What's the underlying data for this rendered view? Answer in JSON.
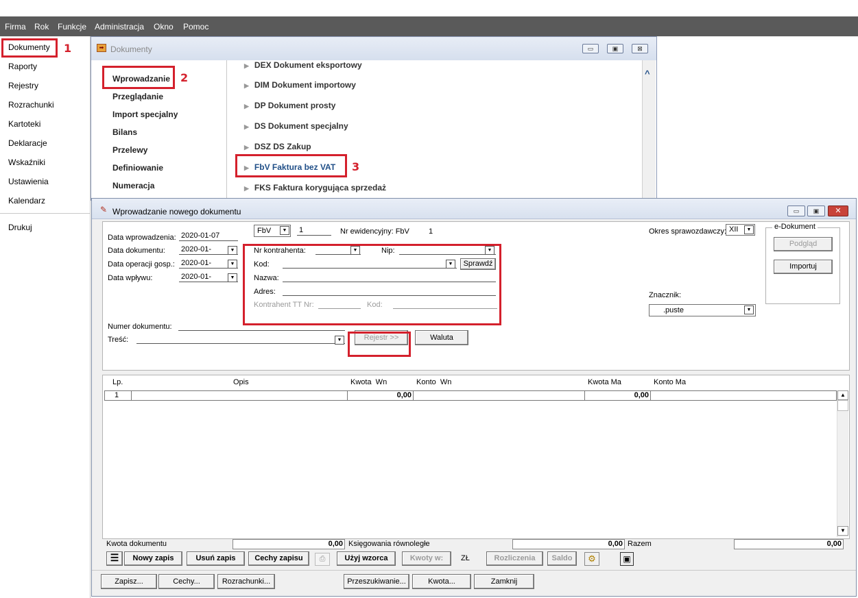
{
  "menubar": [
    "Firma",
    "Rok",
    "Funkcje",
    "Administracja",
    "Okno",
    "Pomoc"
  ],
  "sidebar": {
    "items": [
      "Dokumenty",
      "Raporty",
      "Rejestry",
      "Rozrachunki",
      "Kartoteki",
      "Deklaracje",
      "Wskaźniki",
      "Ustawienia",
      "Kalendarz",
      "Drukuj"
    ]
  },
  "callouts": [
    "1",
    "2",
    "3"
  ],
  "docwin": {
    "title": "Dokumenty",
    "nav": [
      "Wprowadzanie",
      "Przeglądanie",
      "Import specjalny",
      "Bilans",
      "Przelewy",
      "Definiowanie",
      "Numeracja"
    ],
    "documents": [
      "DEX Dokument eksportowy",
      "DIM Dokument importowy",
      "DP Dokument prosty",
      "DS Dokument specjalny",
      "DSZ DS Zakup",
      "FbV Faktura bez VAT",
      "FKS Faktura korygująca sprzedaż"
    ],
    "win_min": "▭",
    "win_max": "▣",
    "win_close": "⊠"
  },
  "dialog": {
    "title": "Wprowadzanie nowego dokumentu",
    "win_min": "▭",
    "win_max": "▣",
    "win_close": "✕",
    "doc_type": "FbV",
    "doc_no": "1",
    "nr_ewid_label": "Nr ewidencyjny: FbV",
    "nr_ewid_value": "1",
    "dates": {
      "wprow_label": "Data wprowadzenia:",
      "wprow_value": "2020-01-07",
      "dok_label": "Data dokumentu:",
      "dok_value": "2020-01-",
      "oper_label": "Data operacji gosp.:",
      "oper_value": "2020-01-",
      "wplyw_label": "Data wpływu:",
      "wplyw_value": "2020-01-"
    },
    "kontrahent": {
      "nr_label": "Nr kontrahenta:",
      "nip_label": "Nip:",
      "kod_label": "Kod:",
      "sprawdz_label": "Sprawdź",
      "nazwa_label": "Nazwa:",
      "adres_label": "Adres:",
      "tt_label": "Kontrahent TT Nr:",
      "tt_kod_label": "Kod:"
    },
    "okres_label": "Okres sprawozdawczy:",
    "okres_value": "XII",
    "edok": {
      "title": "e-Dokument",
      "podglad": "Podgląd",
      "importuj": "Importuj"
    },
    "znacznik_label": "Znacznik:",
    "znacznik_value": ".puste",
    "numer_label": "Numer dokumentu:",
    "tresc_label": "Treść:",
    "rejestr_label": "Rejestr >>",
    "waluta_label": "Waluta",
    "grid": {
      "headers": [
        "Lp.",
        "Opis",
        "Kwota  Wn",
        "Konto  Wn",
        "Kwota Ma",
        "Konto Ma"
      ],
      "rows": [
        {
          "lp": "1",
          "opis": "",
          "kwota_wn": "0,00",
          "konto_wn": "",
          "kwota_ma": "0,00",
          "konto_ma": ""
        }
      ]
    },
    "summary": {
      "kwota_label": "Kwota dokumentu",
      "kwota_value": "0,00",
      "ksieg_label": "Księgowania równoległe",
      "ksieg_value": "0,00",
      "razem_label": "Razem",
      "razem_value": "0,00"
    },
    "toolbar": {
      "nowy": "Nowy zapis",
      "usun": "Usuń zapis",
      "cechy": "Cechy zapisu",
      "uzyj": "Użyj wzorca",
      "kwoty": "Kwoty w:",
      "waluta": "ZŁ",
      "rozliczenia": "Rozliczenia",
      "saldo": "Saldo"
    },
    "footer": {
      "zapisz": "Zapisz...",
      "cechy": "Cechy...",
      "rozrachunki": "Rozrachunki...",
      "przeszukiwanie": "Przeszukiwanie...",
      "kwota": "Kwota...",
      "zamknij": "Zamknij"
    }
  }
}
